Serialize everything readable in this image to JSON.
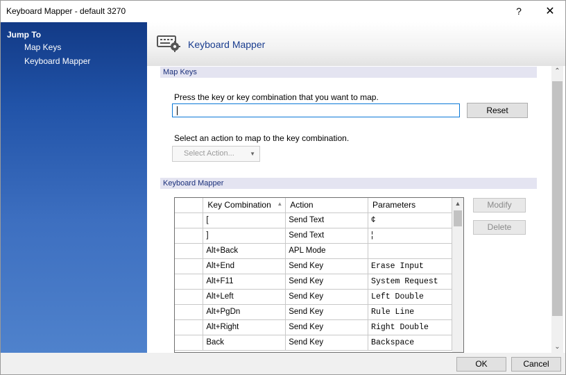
{
  "window": {
    "title": "Keyboard Mapper - default 3270",
    "help_glyph": "?",
    "close_glyph": "✕"
  },
  "sidebar": {
    "heading": "Jump To",
    "links": [
      "Map Keys",
      "Keyboard Mapper"
    ]
  },
  "header": {
    "title": "Keyboard Mapper",
    "icon": "keyboard-gear-icon"
  },
  "map_keys": {
    "section_title": "Map Keys",
    "prompt": "Press the key or key combination that you want to map.",
    "key_input_value": "",
    "reset_label": "Reset",
    "action_prompt": "Select an action to map to the key combination.",
    "action_select_value": "Select Action..."
  },
  "keyboard_mapper": {
    "section_title": "Keyboard Mapper",
    "columns": [
      "Key Combination",
      "Action",
      "Parameters"
    ],
    "rows": [
      [
        "[",
        "Send Text",
        "¢"
      ],
      [
        "]",
        "Send Text",
        "¦"
      ],
      [
        "Alt+Back",
        "APL Mode",
        ""
      ],
      [
        "Alt+End",
        "Send Key",
        "Erase Input"
      ],
      [
        "Alt+F11",
        "Send Key",
        "System Request"
      ],
      [
        "Alt+Left",
        "Send Key",
        "Left Double"
      ],
      [
        "Alt+PgDn",
        "Send Key",
        "Rule Line"
      ],
      [
        "Alt+Right",
        "Send Key",
        "Right Double"
      ],
      [
        "Back",
        "Send Key",
        "Backspace"
      ]
    ],
    "modify_label": "Modify",
    "delete_label": "Delete"
  },
  "footer": {
    "ok_label": "OK",
    "cancel_label": "Cancel"
  },
  "colors": {
    "sidebar_top": "#123a86",
    "sidebar_bottom": "#4f82cc",
    "section_bar": "#e4e4f1",
    "focus_border": "#0a78d7",
    "header_title": "#1a3d8f"
  }
}
